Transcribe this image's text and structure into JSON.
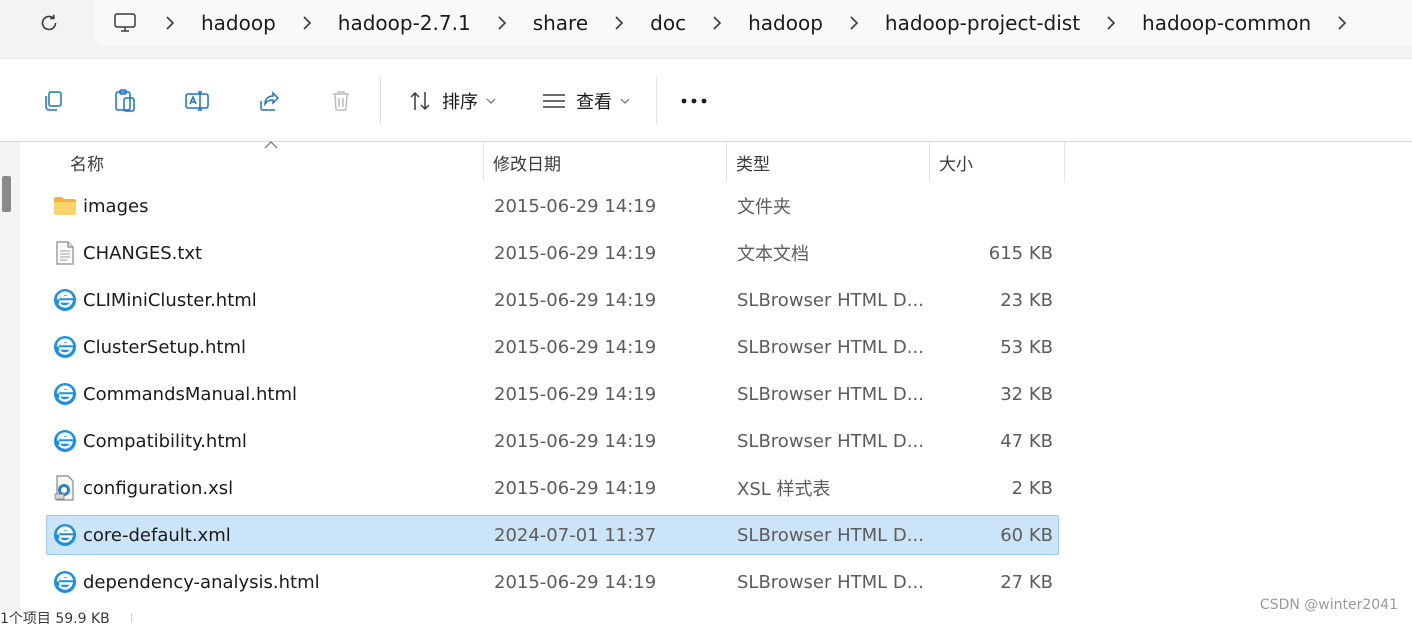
{
  "breadcrumb": {
    "items": [
      "hadoop",
      "hadoop-2.7.1",
      "share",
      "doc",
      "hadoop",
      "hadoop-project-dist",
      "hadoop-common"
    ]
  },
  "toolbar": {
    "sort_label": "排序",
    "view_label": "查看"
  },
  "columns": {
    "name": "名称",
    "date": "修改日期",
    "type": "类型",
    "size": "大小"
  },
  "files": [
    {
      "name": "images",
      "date": "2015-06-29 14:19",
      "type": "文件夹",
      "size": "",
      "icon": "folder-icon"
    },
    {
      "name": "CHANGES.txt",
      "date": "2015-06-29 14:19",
      "type": "文本文档",
      "size": "615 KB",
      "icon": "text-file-icon"
    },
    {
      "name": "CLIMiniCluster.html",
      "date": "2015-06-29 14:19",
      "type": "SLBrowser HTML D...",
      "size": "23 KB",
      "icon": "browser-file-icon"
    },
    {
      "name": "ClusterSetup.html",
      "date": "2015-06-29 14:19",
      "type": "SLBrowser HTML D...",
      "size": "53 KB",
      "icon": "browser-file-icon"
    },
    {
      "name": "CommandsManual.html",
      "date": "2015-06-29 14:19",
      "type": "SLBrowser HTML D...",
      "size": "32 KB",
      "icon": "browser-file-icon"
    },
    {
      "name": "Compatibility.html",
      "date": "2015-06-29 14:19",
      "type": "SLBrowser HTML D...",
      "size": "47 KB",
      "icon": "browser-file-icon"
    },
    {
      "name": "configuration.xsl",
      "date": "2015-06-29 14:19",
      "type": "XSL 样式表",
      "size": "2 KB",
      "icon": "xsl-file-icon"
    },
    {
      "name": "core-default.xml",
      "date": "2024-07-01 11:37",
      "type": "SLBrowser HTML D...",
      "size": "60 KB",
      "icon": "browser-file-icon",
      "selected": true
    },
    {
      "name": "dependency-analysis.html",
      "date": "2015-06-29 14:19",
      "type": "SLBrowser HTML D...",
      "size": "27 KB",
      "icon": "browser-file-icon"
    }
  ],
  "status": {
    "text": "1个项目 59.9 KB"
  },
  "watermark": "CSDN @winter2041"
}
